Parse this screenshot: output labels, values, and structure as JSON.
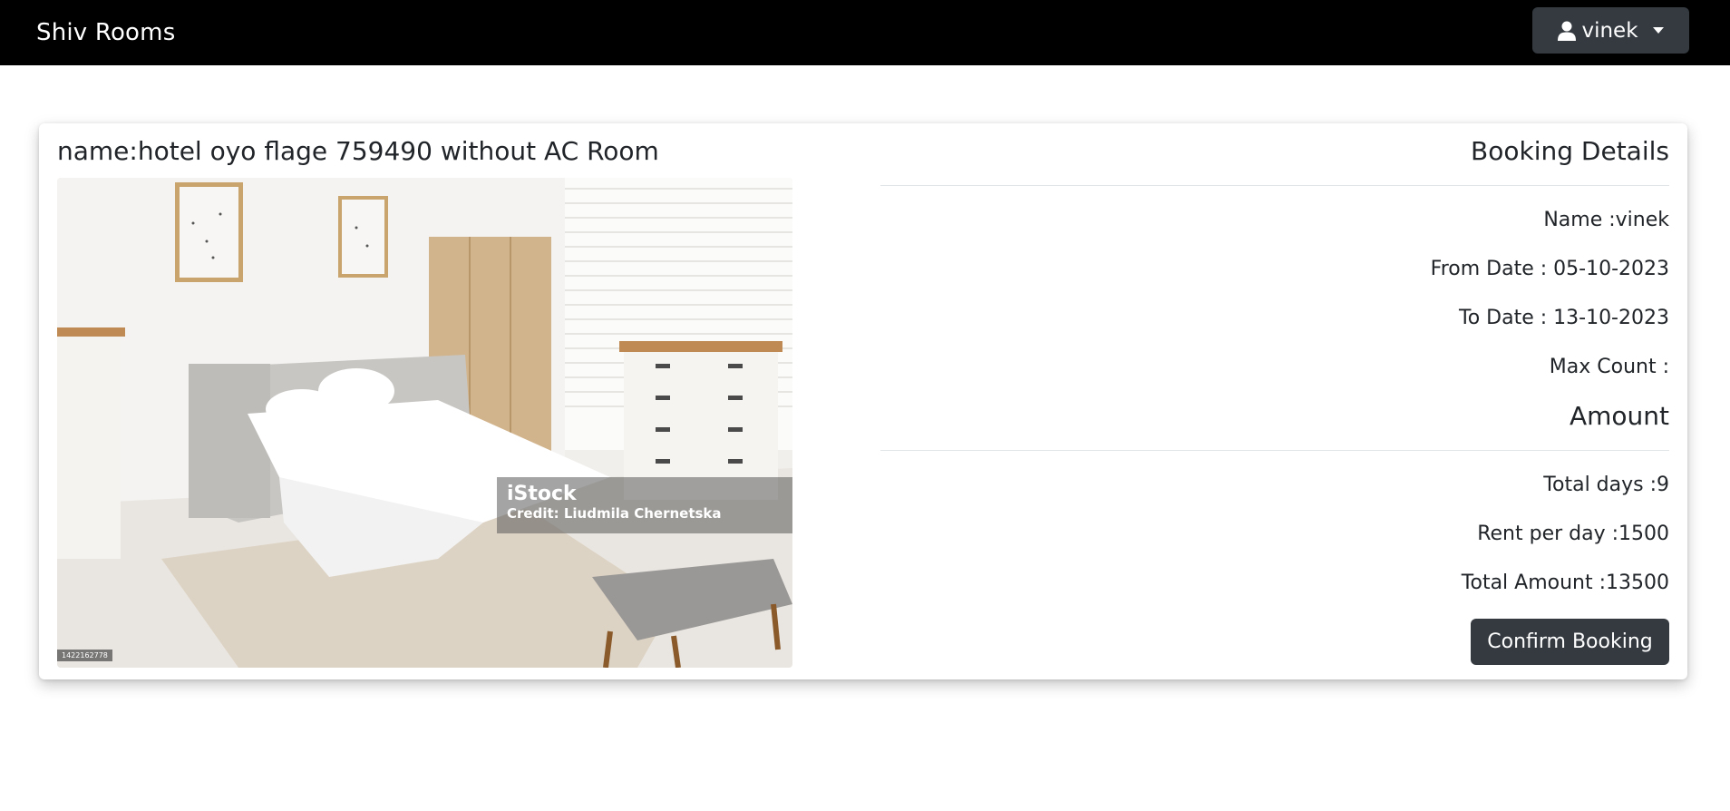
{
  "navbar": {
    "brand": "Shiv Rooms",
    "user_menu": {
      "label": "vinek",
      "icon": "user-icon"
    }
  },
  "room": {
    "title": "name:hotel oyo flage 759490 without AC Room",
    "image": {
      "watermark_brand": "iStock",
      "watermark_credit": "Credit: Liudmila Chernetska",
      "image_id": "1422162778"
    }
  },
  "booking": {
    "heading": "Booking Details",
    "name": "Name :vinek",
    "from_date": "From Date : 05-10-2023",
    "to_date": "To Date : 13-10-2023",
    "max_count": "Max Count :"
  },
  "amount": {
    "heading": "Amount",
    "total_days": "Total days :9",
    "rent_per_day": "Rent per day :1500",
    "total_amount": "Total Amount :13500",
    "confirm_label": "Confirm Booking"
  },
  "colors": {
    "navbar": "#000000",
    "button": "#343a40",
    "text": "#212529"
  }
}
